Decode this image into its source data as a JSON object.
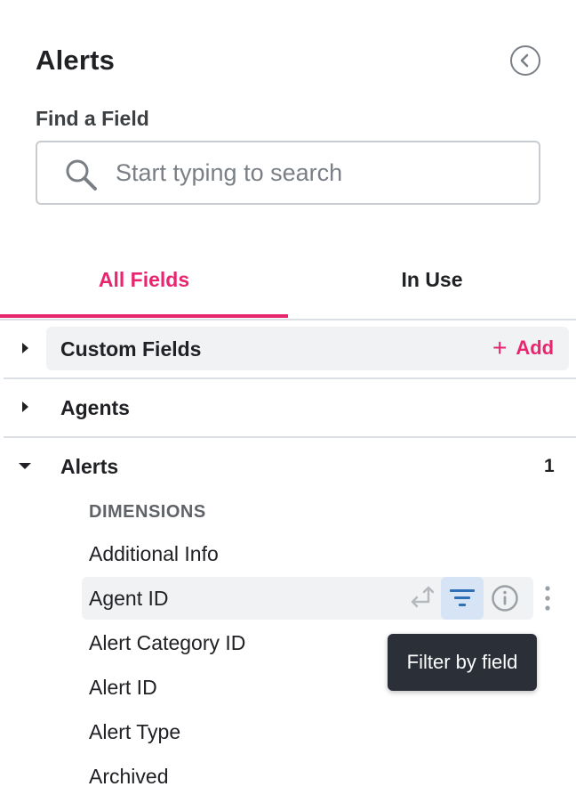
{
  "panel": {
    "title": "Alerts",
    "find_label": "Find a Field",
    "search_placeholder": "Start typing to search",
    "search_value": ""
  },
  "tabs": [
    {
      "label": "All Fields",
      "active": true
    },
    {
      "label": "In Use",
      "active": false
    }
  ],
  "sections": {
    "custom": {
      "label": "Custom Fields",
      "add_label": "Add",
      "add_symbol": "+",
      "expanded": false
    },
    "agents": {
      "label": "Agents",
      "expanded": false
    },
    "alerts": {
      "label": "Alerts",
      "count": "1",
      "expanded": true
    }
  },
  "dimensions": {
    "header": "DIMENSIONS",
    "fields": [
      "Additional Info",
      "Agent ID",
      "Alert Category ID",
      "Alert ID",
      "Alert Type",
      "Archived"
    ]
  },
  "hovered_field_actions": {
    "tooltip": "Filter by field"
  },
  "colors": {
    "accent": "#e8256f",
    "filter_icon": "#2f6fb5",
    "tooltip_bg": "#2b3038",
    "muted_icon": "#b5b9be"
  },
  "icons": {
    "collapse": "chevron-left-circle-icon",
    "search": "search-icon",
    "swap": "swap-icon",
    "filter": "filter-icon",
    "info": "info-icon",
    "more": "more-vertical-icon"
  }
}
